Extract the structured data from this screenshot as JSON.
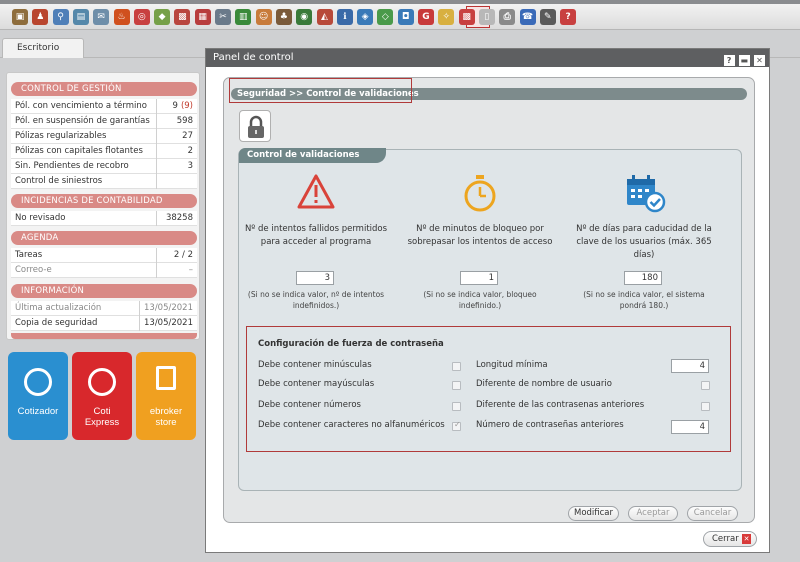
{
  "toolbar": {
    "icons": [
      {
        "name": "box-icon",
        "color": "#8e6d3c"
      },
      {
        "name": "people-icon",
        "color": "#b9462f"
      },
      {
        "name": "search-person-icon",
        "color": "#4f7fb8"
      },
      {
        "name": "document-icon",
        "color": "#5588aa"
      },
      {
        "name": "mail-icon",
        "color": "#6e8ea9"
      },
      {
        "name": "fire-icon",
        "color": "#d0501e"
      },
      {
        "name": "target-icon",
        "color": "#c84040"
      },
      {
        "name": "tag-icon",
        "color": "#76a048"
      },
      {
        "name": "briefcase-icon",
        "color": "#b9463f"
      },
      {
        "name": "calendar-icon",
        "color": "#b83c3c"
      },
      {
        "name": "tools-icon",
        "color": "#6a7a8a"
      },
      {
        "name": "spreadsheet-icon",
        "color": "#3a8a3a"
      },
      {
        "name": "user-icon",
        "color": "#c87b3a"
      },
      {
        "name": "group-icon",
        "color": "#7a5a3a"
      },
      {
        "name": "globe-icon",
        "color": "#3a7a3a"
      },
      {
        "name": "chart-icon",
        "color": "#b84a3a"
      },
      {
        "name": "info-icon",
        "color": "#3a6aa8"
      },
      {
        "name": "drop-icon",
        "color": "#3a7ab8"
      },
      {
        "name": "diamond-icon",
        "color": "#4a9a4a"
      },
      {
        "name": "app-icon",
        "color": "#3a7ab8"
      },
      {
        "name": "g-app-icon",
        "color": "#c83a3a"
      },
      {
        "name": "bulb-icon",
        "color": "#d8b040"
      },
      {
        "name": "control-panel-icon",
        "color": "#c84040"
      },
      {
        "name": "paper-icon",
        "color": "#b8b8b8"
      },
      {
        "name": "print-icon",
        "color": "#8a8a8a"
      },
      {
        "name": "phone-icon",
        "color": "#3a6ab8"
      },
      {
        "name": "wrench-icon",
        "color": "#5a5a5a"
      },
      {
        "name": "help-icon",
        "color": "#c84040"
      }
    ]
  },
  "tab": {
    "label": "Escritorio"
  },
  "left": {
    "gestion_title": "CONTROL DE GESTIÓN",
    "gestion_rows": [
      {
        "label": "Pól. con vencimiento a término",
        "value": "9",
        "extra": "(9)"
      },
      {
        "label": "Pól. en suspensión de garantías",
        "value": "598"
      },
      {
        "label": "Pólizas regularizables",
        "value": "27"
      },
      {
        "label": "Pólizas con capitales flotantes",
        "value": "2"
      },
      {
        "label": "Sin. Pendientes de recobro",
        "value": "3"
      },
      {
        "label": "Control de siniestros",
        "value": ""
      }
    ],
    "contab_title": "INCIDENCIAS DE CONTABILIDAD",
    "contab_rows": [
      {
        "label": "No revisado",
        "value": "38258"
      }
    ],
    "agenda_title": "AGENDA",
    "agenda_rows": [
      {
        "label": "Tareas",
        "value": "2 / 2"
      },
      {
        "label": "Correo-e",
        "value": "–"
      }
    ],
    "info_title": "INFORMACIÓN",
    "info_rows": [
      {
        "label": "Última actualización",
        "value": "13/05/2021"
      },
      {
        "label": "Copia de seguridad",
        "value": "13/05/2021"
      }
    ],
    "tiles": [
      {
        "line1": "Cotizador",
        "line2": "",
        "color": "#2a8fd0"
      },
      {
        "line1": "Coti",
        "line2": "Express",
        "color": "#d8282c"
      },
      {
        "line1": "ebroker",
        "line2": "store",
        "color": "#f0a020"
      }
    ]
  },
  "dialog": {
    "title": "Panel de control",
    "title_buttons": [
      "?",
      "▬",
      "✕"
    ],
    "breadcrumb": "Seguridad >> Control de validaciones",
    "panel_title": "Control de validaciones",
    "columns": [
      {
        "icon": "warning-icon",
        "desc": "Nº de intentos fallidos permitidos para acceder al programa",
        "value": "3",
        "hint": "(Si no se indica valor, nº de intentos indefinidos.)"
      },
      {
        "icon": "stopwatch-icon",
        "desc": "Nº de minutos de bloqueo por sobrepasar los intentos de acceso",
        "value": "1",
        "hint": "(Si no se indica valor, bloqueo indefinido.)"
      },
      {
        "icon": "calendar-check-icon",
        "desc": "Nº de días para caducidad de la clave de los usuarios (máx. 365 días)",
        "value": "180",
        "hint": "(Si no se indica valor, el sistema pondrá 180.)"
      }
    ],
    "password": {
      "title": "Configuración de fuerza de contraseña",
      "left": [
        {
          "label": "Debe contener minúsculas",
          "checked": false
        },
        {
          "label": "Debe contener mayúsculas",
          "checked": false
        },
        {
          "label": "Debe contener números",
          "checked": false
        },
        {
          "label": "Debe contener caracteres no alfanuméricos",
          "checked": true
        }
      ],
      "right": [
        {
          "label": "Longitud mínima",
          "value": "4"
        },
        {
          "label": "Diferente de nombre de usuario",
          "checked": false
        },
        {
          "label": "Diferente de las contrasenas anteriores",
          "checked": false
        },
        {
          "label": "Número de contraseñas anteriores",
          "value": "4"
        }
      ]
    },
    "buttons": {
      "modify": "Modificar",
      "accept": "Aceptar",
      "cancel": "Cancelar"
    },
    "close": "Cerrar"
  }
}
